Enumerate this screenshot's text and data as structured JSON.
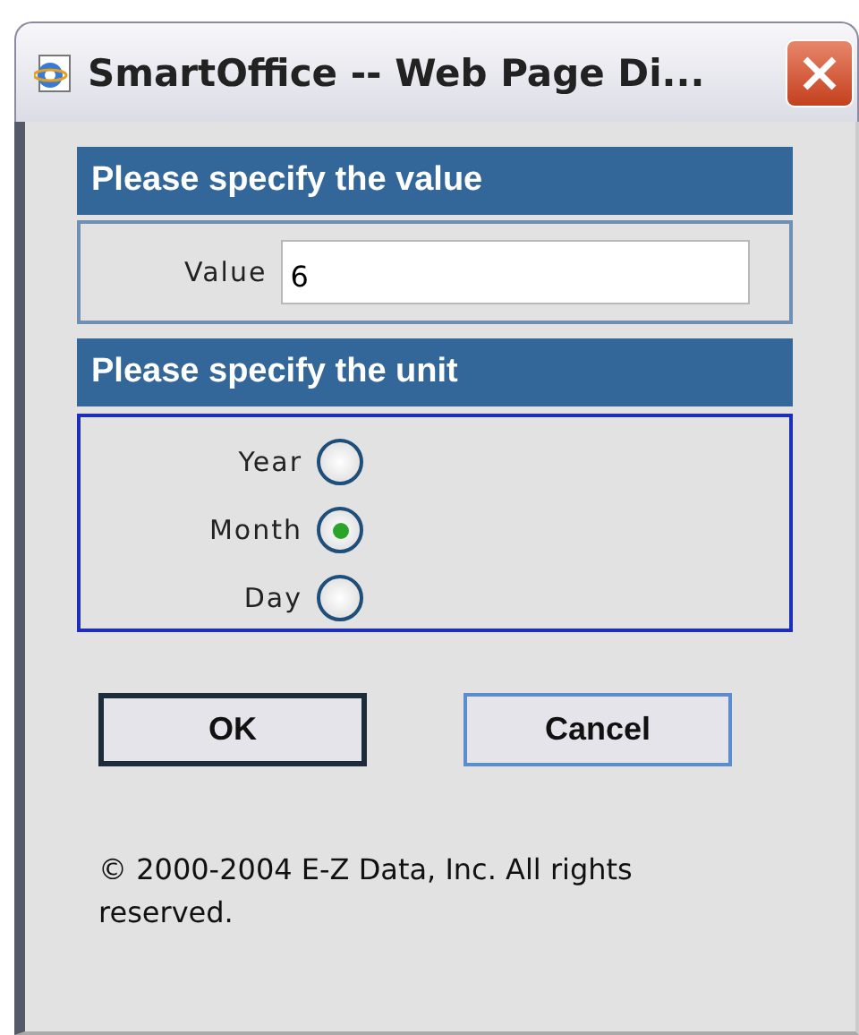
{
  "window": {
    "title": "SmartOffice -- Web Page Di..."
  },
  "value_section": {
    "heading": "Please specify the value",
    "label": "Value",
    "value": "6"
  },
  "unit_section": {
    "heading": "Please specify the unit",
    "options": [
      {
        "label": "Year",
        "selected": false
      },
      {
        "label": "Month",
        "selected": true
      },
      {
        "label": "Day",
        "selected": false
      }
    ]
  },
  "buttons": [
    {
      "label": "OK",
      "default": true
    },
    {
      "label": "Cancel",
      "default": false
    }
  ],
  "footer": "© 2000-2004 E-Z Data, Inc. All rights reserved."
}
